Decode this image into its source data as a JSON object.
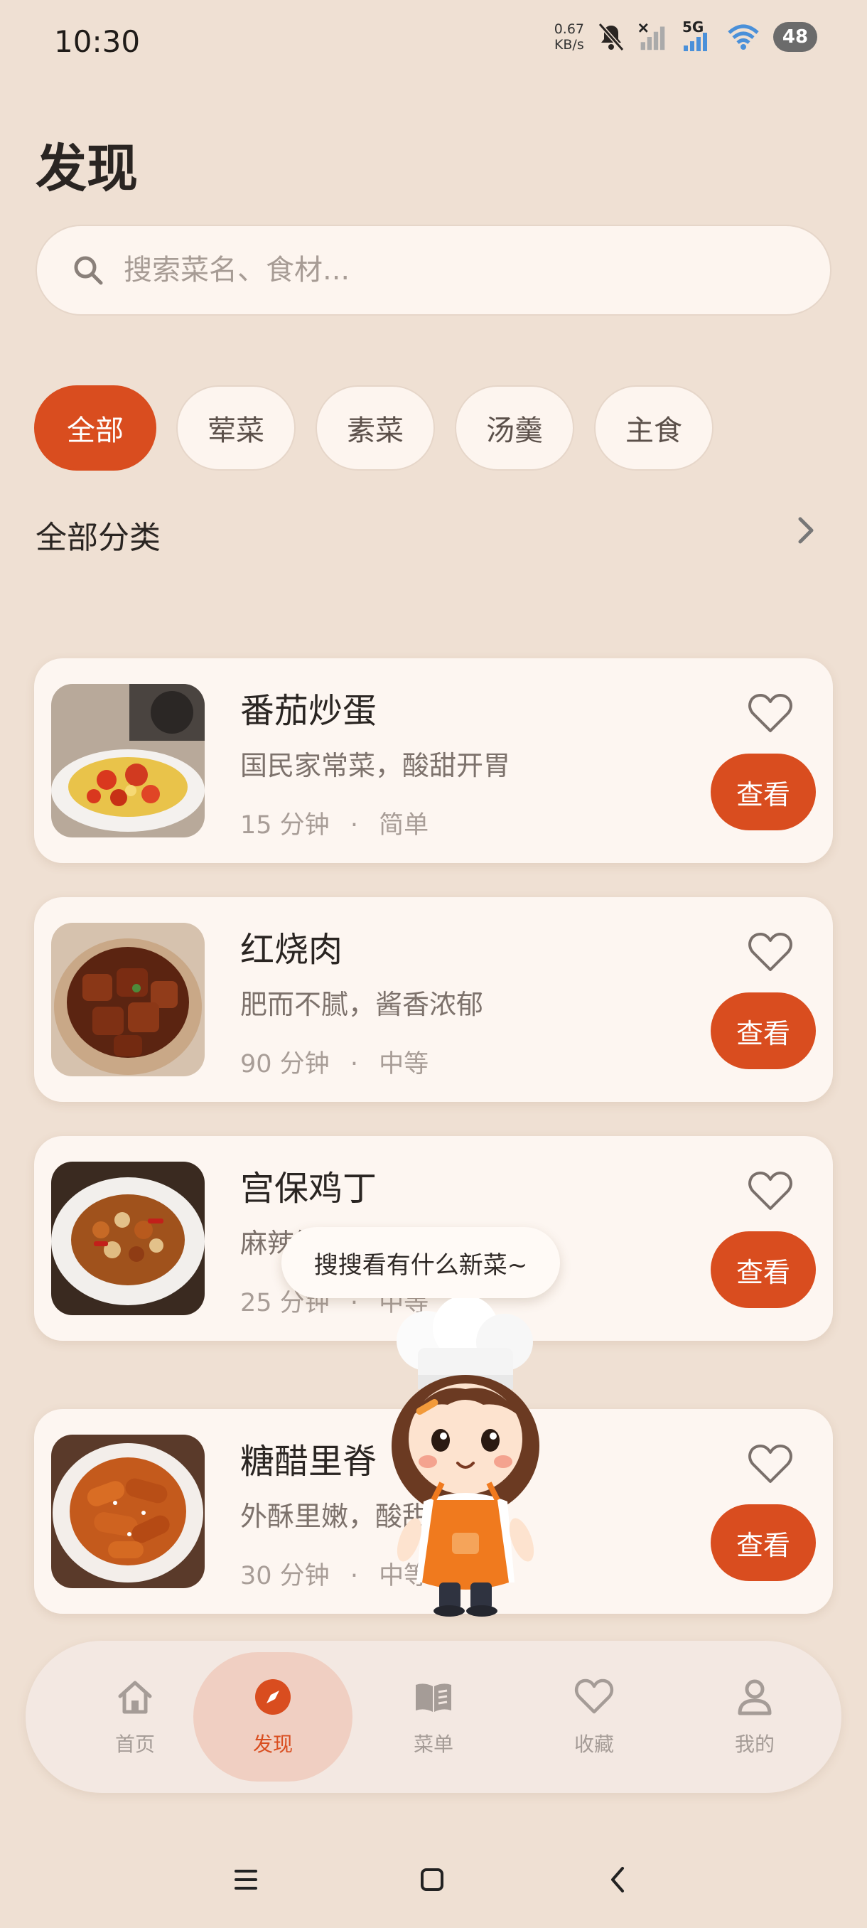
{
  "status_bar": {
    "time": "10:30",
    "net_speed_value": "0.67",
    "net_speed_unit": "KB/s",
    "network": "5G",
    "battery": "48"
  },
  "page_title": "发现",
  "search": {
    "placeholder": "搜索菜名、食材..."
  },
  "categories": [
    {
      "label": "全部",
      "active": true
    },
    {
      "label": "荤菜",
      "active": false
    },
    {
      "label": "素菜",
      "active": false
    },
    {
      "label": "汤羹",
      "active": false
    },
    {
      "label": "主食",
      "active": false
    }
  ],
  "section": {
    "title": "全部分类"
  },
  "recipes": [
    {
      "name": "番茄炒蛋",
      "desc": "国民家常菜，酸甜开胃",
      "time": "15 分钟",
      "difficulty": "简单",
      "view_label": "查看"
    },
    {
      "name": "红烧肉",
      "desc": "肥而不腻，酱香浓郁",
      "time": "90 分钟",
      "difficulty": "中等",
      "view_label": "查看"
    },
    {
      "name": "宫保鸡丁",
      "desc": "麻辣鲜香，下饭神器",
      "time": "25 分钟",
      "difficulty": "中等",
      "view_label": "查看"
    },
    {
      "name": "糖醋里脊",
      "desc": "外酥里嫩，酸甜可口",
      "time": "30 分钟",
      "difficulty": "中等",
      "view_label": "查看"
    }
  ],
  "tooltip": "搜搜看有什么新菜~",
  "bottom_nav": [
    {
      "label": "首页",
      "icon": "home-icon",
      "active": false
    },
    {
      "label": "发现",
      "icon": "compass-icon",
      "active": true
    },
    {
      "label": "菜单",
      "icon": "book-icon",
      "active": false
    },
    {
      "label": "收藏",
      "icon": "heart-icon",
      "active": false
    },
    {
      "label": "我的",
      "icon": "user-icon",
      "active": false
    }
  ],
  "colors": {
    "accent": "#d94d1f",
    "background": "#efe0d3",
    "card": "#fdf6f1"
  },
  "meta_separator": "·"
}
